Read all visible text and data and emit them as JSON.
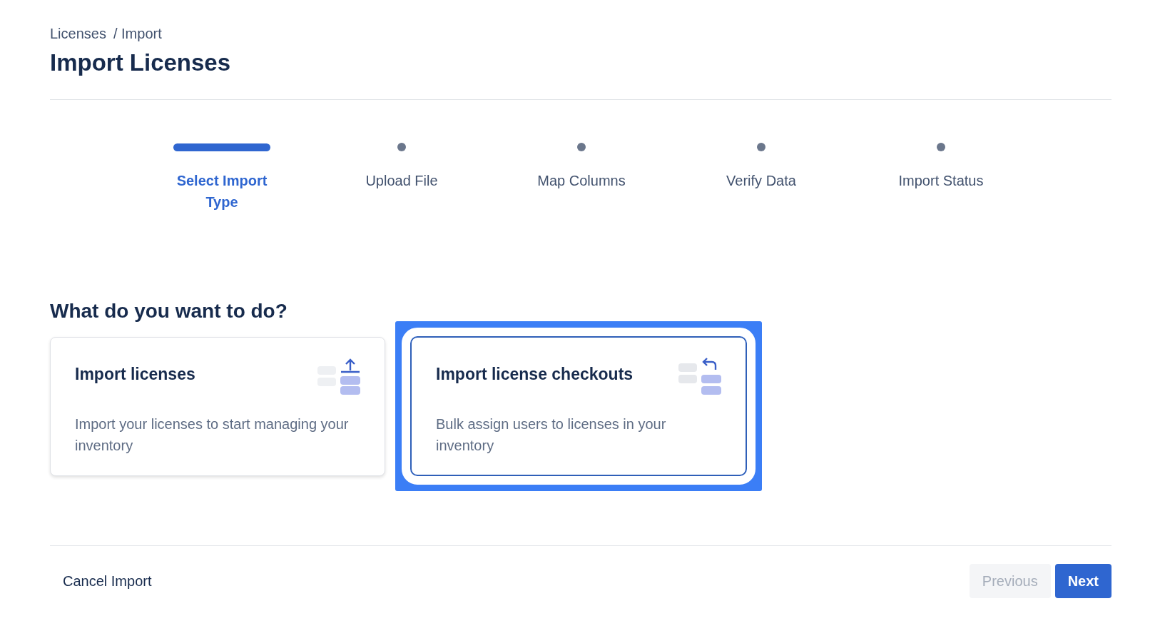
{
  "breadcrumb": [
    "Licenses",
    "/ Import"
  ],
  "title": "Import Licenses",
  "steps": [
    {
      "label": "Select Import Type",
      "selected": true
    },
    {
      "label": "Upload File",
      "selected": false
    },
    {
      "label": "Map Columns",
      "selected": false
    },
    {
      "label": "Verify Data",
      "selected": false
    },
    {
      "label": "Import Status",
      "selected": false
    }
  ],
  "question": "What do you want to do?",
  "options": [
    {
      "kind": "upload",
      "title": "Import licenses",
      "description": "Import your licenses to start managing your inventory",
      "selected": false
    },
    {
      "kind": "return",
      "title": "Import license checkouts",
      "description": "Bulk assign users to licenses in your inventory",
      "selected": true
    }
  ],
  "footer": {
    "cancel": "Cancel Import",
    "previous": {
      "label": "Previous",
      "disabled": true
    },
    "next": {
      "label": "Next",
      "disabled": false
    }
  }
}
